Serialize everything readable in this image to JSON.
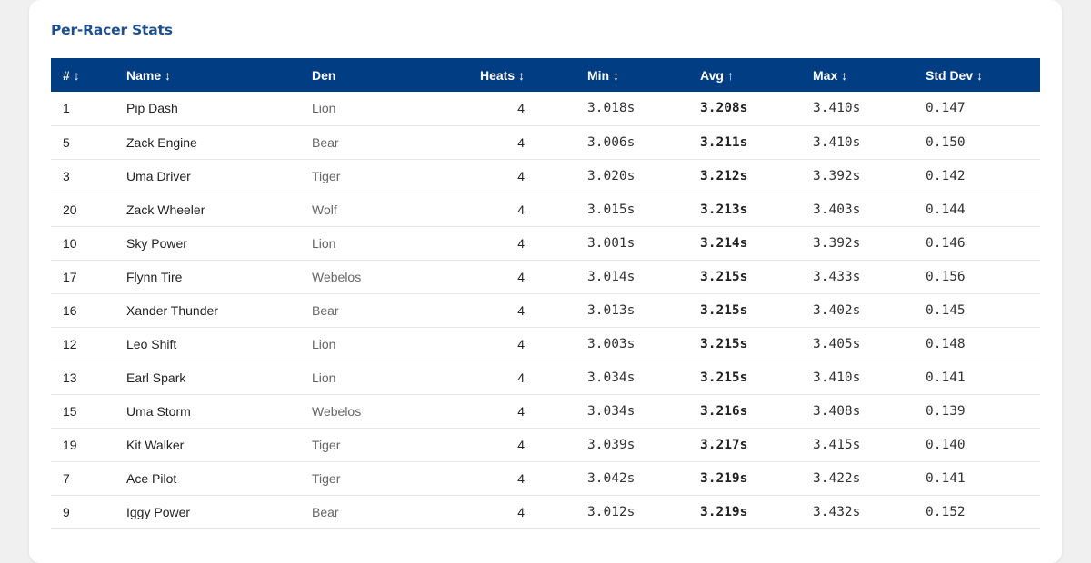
{
  "section": {
    "title": "Per-Racer Stats"
  },
  "table": {
    "columns": [
      {
        "key": "num",
        "label": "# ↕"
      },
      {
        "key": "name",
        "label": "Name ↕"
      },
      {
        "key": "den",
        "label": "Den"
      },
      {
        "key": "heats",
        "label": "Heats ↕"
      },
      {
        "key": "min",
        "label": "Min ↕"
      },
      {
        "key": "avg",
        "label": "Avg ↑"
      },
      {
        "key": "max",
        "label": "Max ↕"
      },
      {
        "key": "std",
        "label": "Std Dev ↕"
      }
    ],
    "rows": [
      {
        "num": "1",
        "name": "Pip Dash",
        "den": "Lion",
        "heats": "4",
        "min": "3.018s",
        "avg": "3.208s",
        "max": "3.410s",
        "std": "0.147"
      },
      {
        "num": "5",
        "name": "Zack Engine",
        "den": "Bear",
        "heats": "4",
        "min": "3.006s",
        "avg": "3.211s",
        "max": "3.410s",
        "std": "0.150"
      },
      {
        "num": "3",
        "name": "Uma Driver",
        "den": "Tiger",
        "heats": "4",
        "min": "3.020s",
        "avg": "3.212s",
        "max": "3.392s",
        "std": "0.142"
      },
      {
        "num": "20",
        "name": "Zack Wheeler",
        "den": "Wolf",
        "heats": "4",
        "min": "3.015s",
        "avg": "3.213s",
        "max": "3.403s",
        "std": "0.144"
      },
      {
        "num": "10",
        "name": "Sky Power",
        "den": "Lion",
        "heats": "4",
        "min": "3.001s",
        "avg": "3.214s",
        "max": "3.392s",
        "std": "0.146"
      },
      {
        "num": "17",
        "name": "Flynn Tire",
        "den": "Webelos",
        "heats": "4",
        "min": "3.014s",
        "avg": "3.215s",
        "max": "3.433s",
        "std": "0.156"
      },
      {
        "num": "16",
        "name": "Xander Thunder",
        "den": "Bear",
        "heats": "4",
        "min": "3.013s",
        "avg": "3.215s",
        "max": "3.402s",
        "std": "0.145"
      },
      {
        "num": "12",
        "name": "Leo Shift",
        "den": "Lion",
        "heats": "4",
        "min": "3.003s",
        "avg": "3.215s",
        "max": "3.405s",
        "std": "0.148"
      },
      {
        "num": "13",
        "name": "Earl Spark",
        "den": "Lion",
        "heats": "4",
        "min": "3.034s",
        "avg": "3.215s",
        "max": "3.410s",
        "std": "0.141"
      },
      {
        "num": "15",
        "name": "Uma Storm",
        "den": "Webelos",
        "heats": "4",
        "min": "3.034s",
        "avg": "3.216s",
        "max": "3.408s",
        "std": "0.139"
      },
      {
        "num": "19",
        "name": "Kit Walker",
        "den": "Tiger",
        "heats": "4",
        "min": "3.039s",
        "avg": "3.217s",
        "max": "3.415s",
        "std": "0.140"
      },
      {
        "num": "7",
        "name": "Ace Pilot",
        "den": "Tiger",
        "heats": "4",
        "min": "3.042s",
        "avg": "3.219s",
        "max": "3.422s",
        "std": "0.141"
      },
      {
        "num": "9",
        "name": "Iggy Power",
        "den": "Bear",
        "heats": "4",
        "min": "3.012s",
        "avg": "3.219s",
        "max": "3.432s",
        "std": "0.152"
      }
    ]
  },
  "colors": {
    "header_bg": "#003d82",
    "title": "#1f4e8c",
    "page_bg": "#f0f0f0"
  }
}
